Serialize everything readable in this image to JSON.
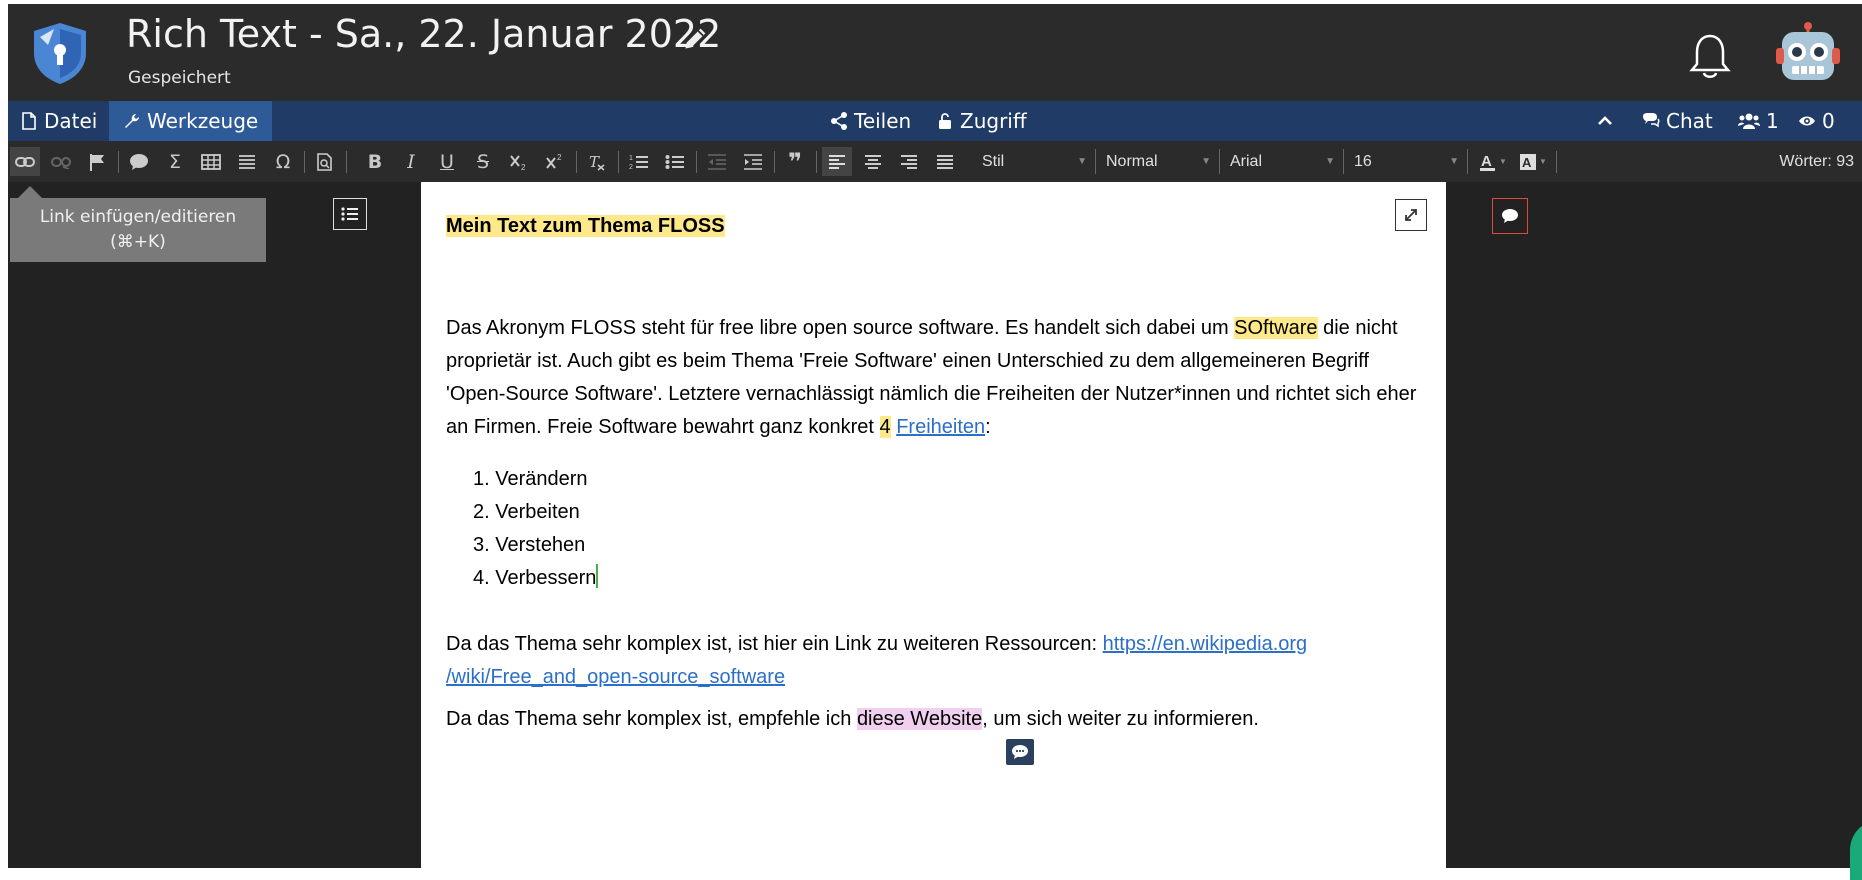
{
  "header": {
    "title": "Rich Text - Sa., 22. Januar 2022",
    "save_status": "Gespeichert"
  },
  "menubar": {
    "datei": "Datei",
    "werkzeuge": "Werkzeuge",
    "teilen": "Teilen",
    "zugriff": "Zugriff",
    "chat": "Chat",
    "users_count": "1",
    "viewers_count": "0"
  },
  "toolbar": {
    "bold": "B",
    "italic": "I",
    "underline": "U",
    "strike": "S",
    "omega": "Ω",
    "sigma": "Σ",
    "quote": "❞",
    "style_combo": "Stil",
    "format_combo": "Normal",
    "font_combo": "Arial",
    "size_combo": "16",
    "word_count": "Wörter: 93"
  },
  "tooltip": {
    "line1": "Link einfügen/editieren",
    "line2": "(⌘+K)"
  },
  "document": {
    "heading": "Mein Text zum Thema FLOSS",
    "p1_a": "Das Akronym FLOSS steht für free libre open source software. Es handelt sich dabei um ",
    "p1_hl": "SOftware",
    "p1_b": " die nicht proprietär ist. Auch gibt es beim Thema 'Freie Software' einen Unterschied zu dem allgemeineren Begriff 'Open-Source Software'. Letztere vernachlässigt nämlich die Freiheiten der Nutzer*innen und richtet sich eher an Firmen. Freie Software bewahrt ganz konkret ",
    "p1_num": "4",
    "p1_link": "Freiheiten",
    "p1_end": ":",
    "list": [
      "1. Verändern",
      "2. Verbeiten",
      "3. Verstehen",
      "4. Verbessern"
    ],
    "p2_a": "Da das Thema sehr komplex ist, ist hier ein Link zu weiteren Ressourcen: ",
    "p2_link1": "https://en.wikipedia.org",
    "p2_link2": "/wiki/Free_and_open-source_software",
    "p3_a": "Da das Thema sehr komplex ist, empfehle ich ",
    "p3_hl": "diese Website",
    "p3_b": ", um sich weiter zu informieren."
  },
  "colors": {
    "header_bg": "#2b2b2b",
    "menubar_bg": "#1f3b66",
    "active_menu": "#2e5a98",
    "highlight_yellow": "#fde98a",
    "highlight_pink": "#f0d0ee",
    "link": "#2b6fc8",
    "comment_border": "#e04a3a"
  }
}
